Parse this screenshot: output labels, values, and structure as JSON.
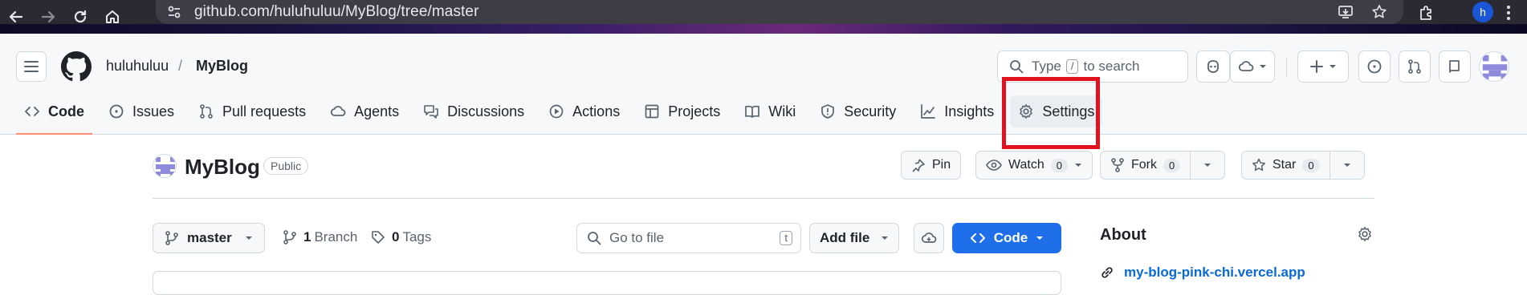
{
  "browser": {
    "url": "github.com/huluhuluu/MyBlog/tree/master",
    "profile_initial": "h"
  },
  "header": {
    "owner": "huluhuluu",
    "separator": "/",
    "repo": "MyBlog",
    "search": {
      "prefix": "Type",
      "key": "/",
      "suffix": "to search"
    }
  },
  "tabs": [
    {
      "label": "Code",
      "icon": "code-icon"
    },
    {
      "label": "Issues",
      "icon": "issue-icon"
    },
    {
      "label": "Pull requests",
      "icon": "pull-request-icon"
    },
    {
      "label": "Agents",
      "icon": "agents-icon"
    },
    {
      "label": "Discussions",
      "icon": "discussions-icon"
    },
    {
      "label": "Actions",
      "icon": "play-icon"
    },
    {
      "label": "Projects",
      "icon": "table-icon"
    },
    {
      "label": "Wiki",
      "icon": "book-icon"
    },
    {
      "label": "Security",
      "icon": "shield-icon"
    },
    {
      "label": "Insights",
      "icon": "graph-icon"
    },
    {
      "label": "Settings",
      "icon": "gear-icon"
    }
  ],
  "repo": {
    "name": "MyBlog",
    "visibility": "Public",
    "pin_label": "Pin",
    "watch_label": "Watch",
    "watch_count": "0",
    "fork_label": "Fork",
    "fork_count": "0",
    "star_label": "Star",
    "star_count": "0"
  },
  "toolbar": {
    "branch": "master",
    "branch_count": "1",
    "branch_label": "Branch",
    "tag_count": "0",
    "tag_label": "Tags",
    "goto_placeholder": "Go to file",
    "goto_key": "t",
    "add_file_label": "Add file",
    "code_label": "Code"
  },
  "about": {
    "title": "About",
    "link": "my-blog-pink-chi.vercel.app"
  },
  "colors": {
    "accent_blue": "#1f6feb",
    "link_blue": "#0969da",
    "highlight_red": "#e0121f",
    "tab_underline": "#fd8c73"
  }
}
